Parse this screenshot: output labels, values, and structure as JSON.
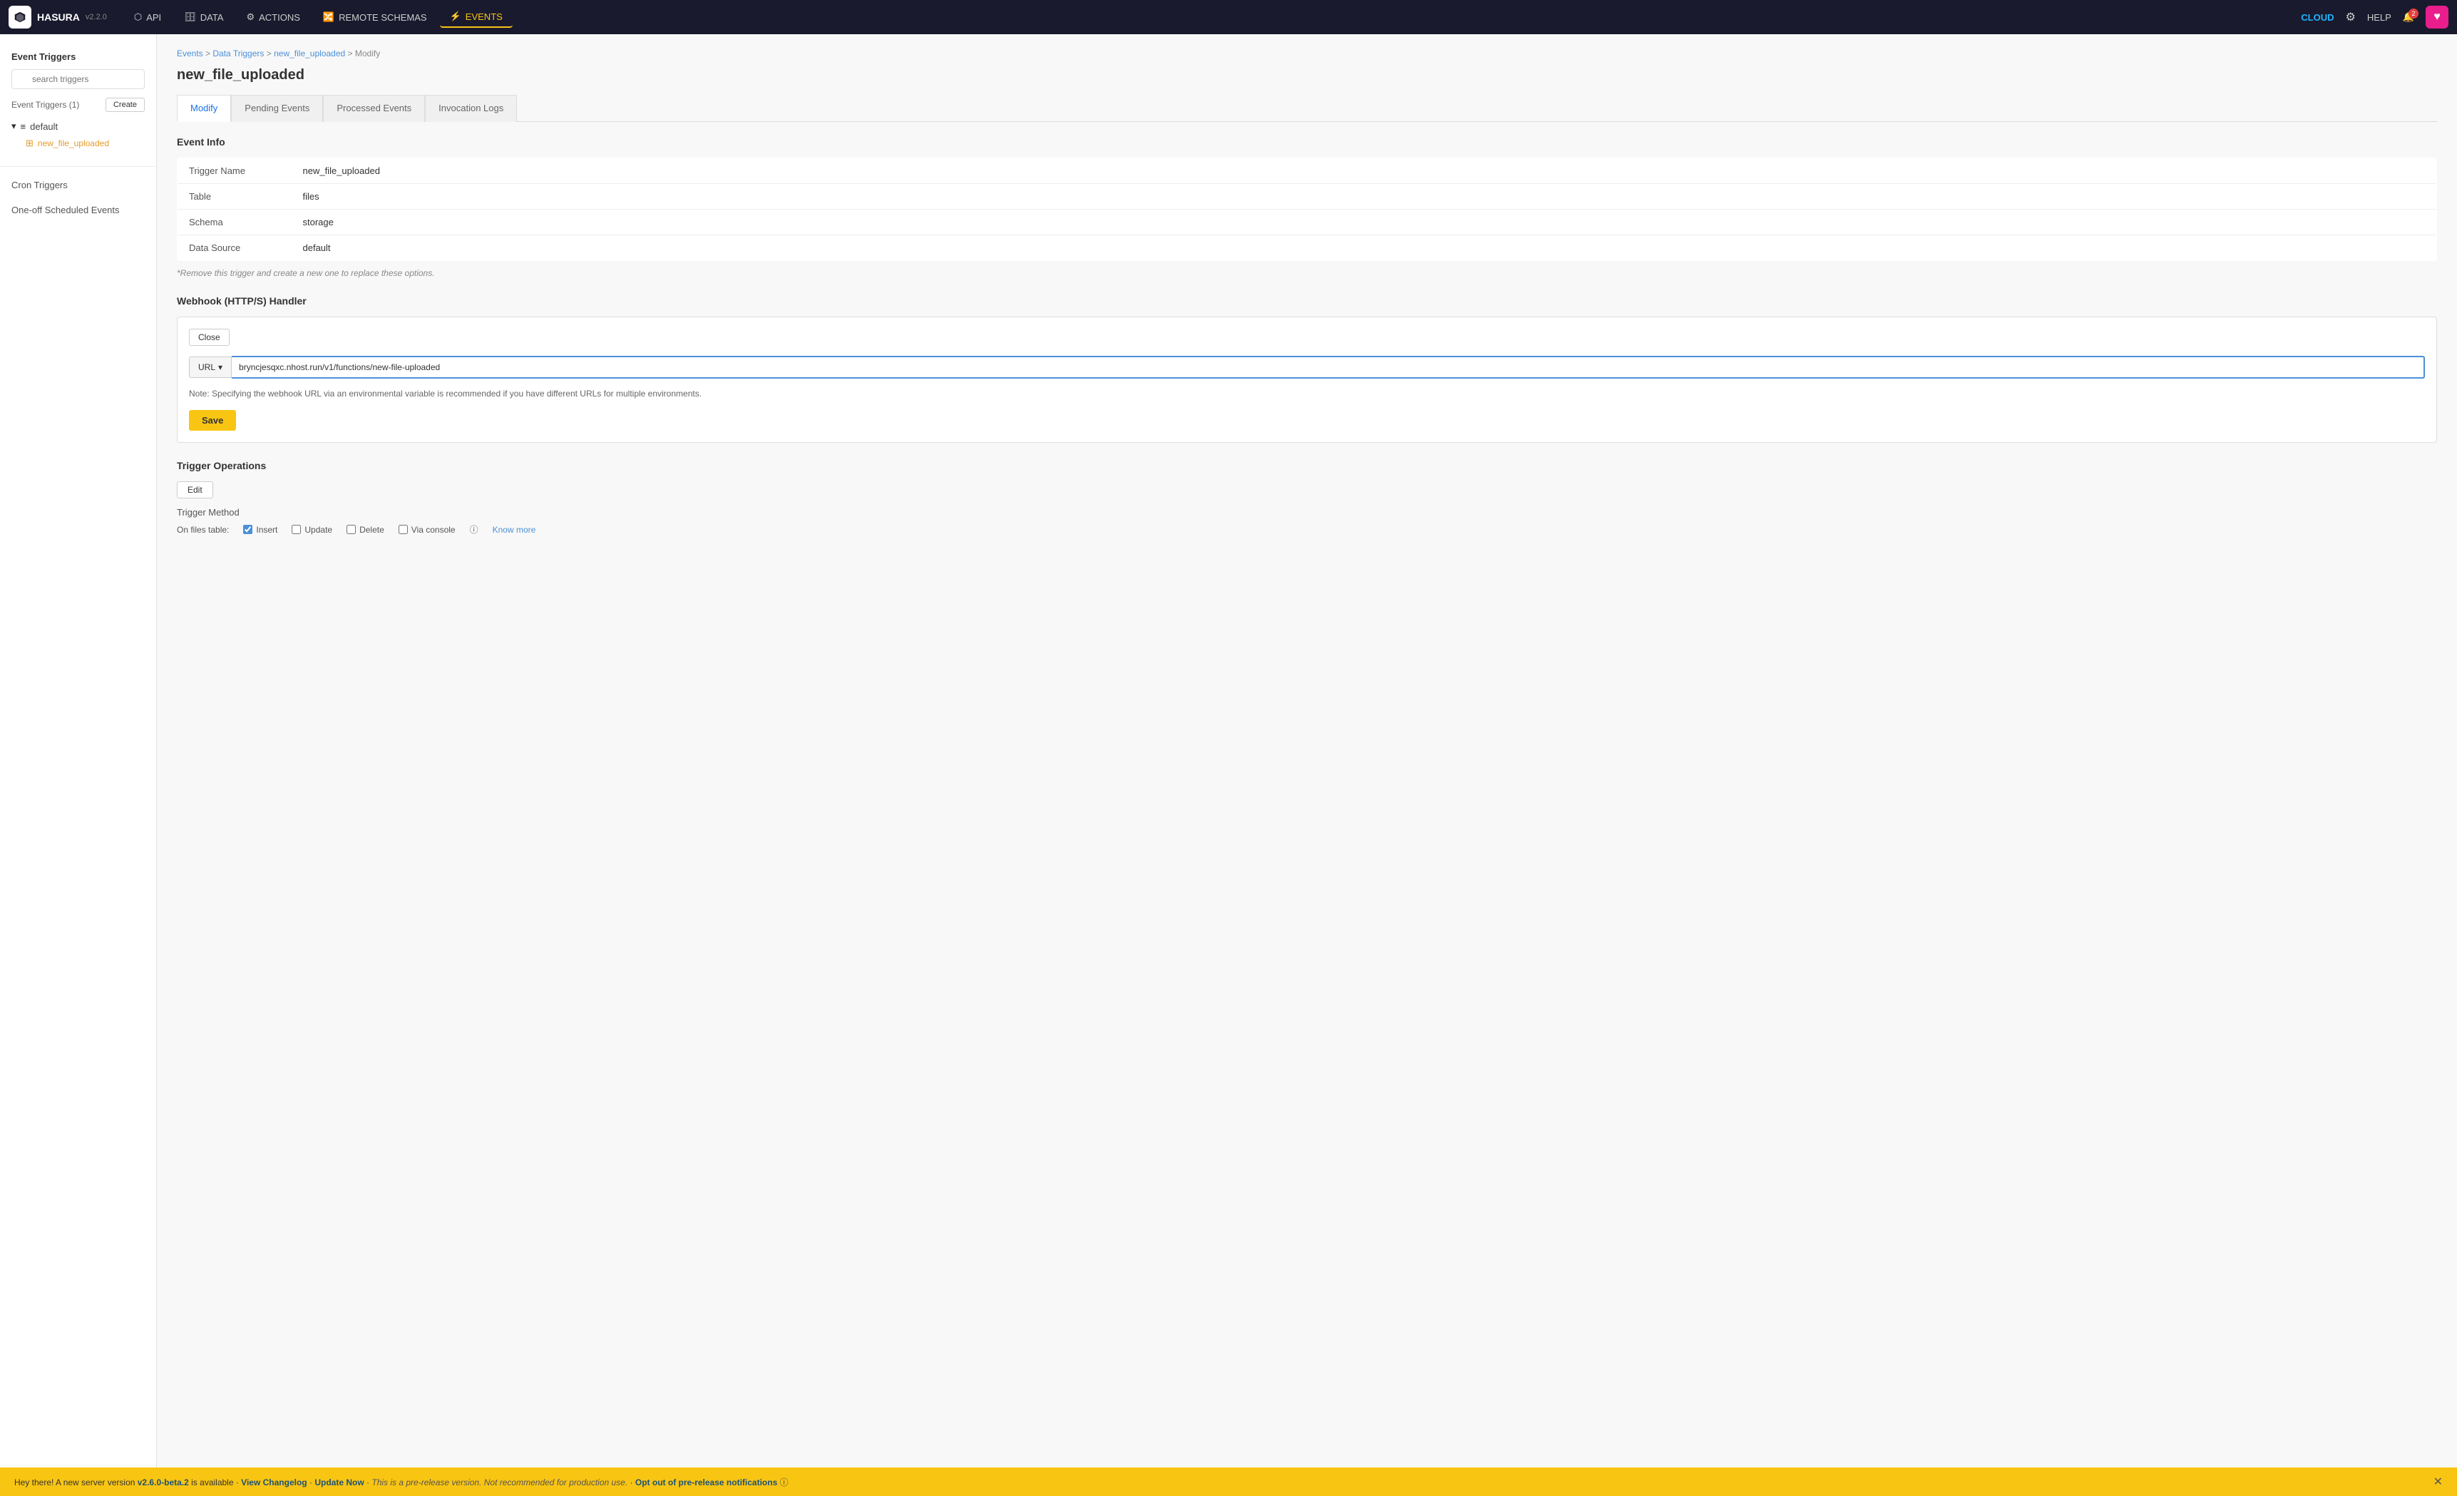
{
  "app": {
    "name": "HASURA",
    "version": "v2.2.0"
  },
  "nav": {
    "items": [
      {
        "id": "api",
        "label": "API",
        "icon": "⬡",
        "active": false
      },
      {
        "id": "data",
        "label": "DATA",
        "icon": "🗄",
        "active": false
      },
      {
        "id": "actions",
        "label": "ACTIONS",
        "icon": "⚡",
        "active": false
      },
      {
        "id": "remote-schemas",
        "label": "REMOTE SCHEMAS",
        "icon": "🔗",
        "active": false
      },
      {
        "id": "events",
        "label": "EVENTS",
        "icon": "⚡",
        "active": true
      }
    ],
    "cloud_label": "CLOUD",
    "help_label": "HELP",
    "bell_count": "2"
  },
  "sidebar": {
    "title": "Event Triggers",
    "search_placeholder": "search triggers",
    "triggers_label": "Event Triggers (1)",
    "create_label": "Create",
    "db_name": "default",
    "trigger_name": "new_file_uploaded",
    "cron_triggers_label": "Cron Triggers",
    "one_off_label": "One-off Scheduled Events"
  },
  "breadcrumb": {
    "items": [
      "Events",
      "Data Triggers",
      "new_file_uploaded",
      "Modify"
    ]
  },
  "page": {
    "title": "new_file_uploaded"
  },
  "tabs": [
    {
      "id": "modify",
      "label": "Modify",
      "active": true
    },
    {
      "id": "pending",
      "label": "Pending Events",
      "active": false
    },
    {
      "id": "processed",
      "label": "Processed Events",
      "active": false
    },
    {
      "id": "invocation",
      "label": "Invocation Logs",
      "active": false
    }
  ],
  "event_info": {
    "section_title": "Event Info",
    "rows": [
      {
        "label": "Trigger Name",
        "value": "new_file_uploaded"
      },
      {
        "label": "Table",
        "value": "files"
      },
      {
        "label": "Schema",
        "value": "storage"
      },
      {
        "label": "Data Source",
        "value": "default"
      }
    ],
    "note": "*Remove this trigger and create a new one to replace these options."
  },
  "webhook": {
    "section_title": "Webhook (HTTP/S) Handler",
    "close_label": "Close",
    "url_type": "URL",
    "url_value": "bryncjesqxc.nhost.run/v1/functions/new-file-uploaded",
    "note": "Note: Specifying the webhook URL via an environmental variable is recommended if you have different URLs for multiple environments.",
    "save_label": "Save"
  },
  "trigger_ops": {
    "section_title": "Trigger Operations",
    "edit_label": "Edit",
    "method_label": "Trigger Method",
    "on_files_label": "On files table:",
    "checkboxes": [
      {
        "label": "Insert",
        "checked": true
      },
      {
        "label": "Update",
        "checked": false
      },
      {
        "label": "Delete",
        "checked": false
      },
      {
        "label": "Via console",
        "checked": false
      }
    ],
    "know_more_label": "Know more"
  },
  "banner": {
    "text": "Hey there! A new server version ",
    "version": "v2.6.0-beta.2",
    "is_available": " is available  ·  ",
    "view_changelog": "View Changelog",
    "separator1": "  ·  ",
    "update_now": "Update Now",
    "separator2": "  ·  ",
    "pre_release_note": "This is a pre-release version. Not recommended for production use.",
    "separator3": "  ·  ",
    "opt_out": "Opt out of pre-release notifications"
  }
}
